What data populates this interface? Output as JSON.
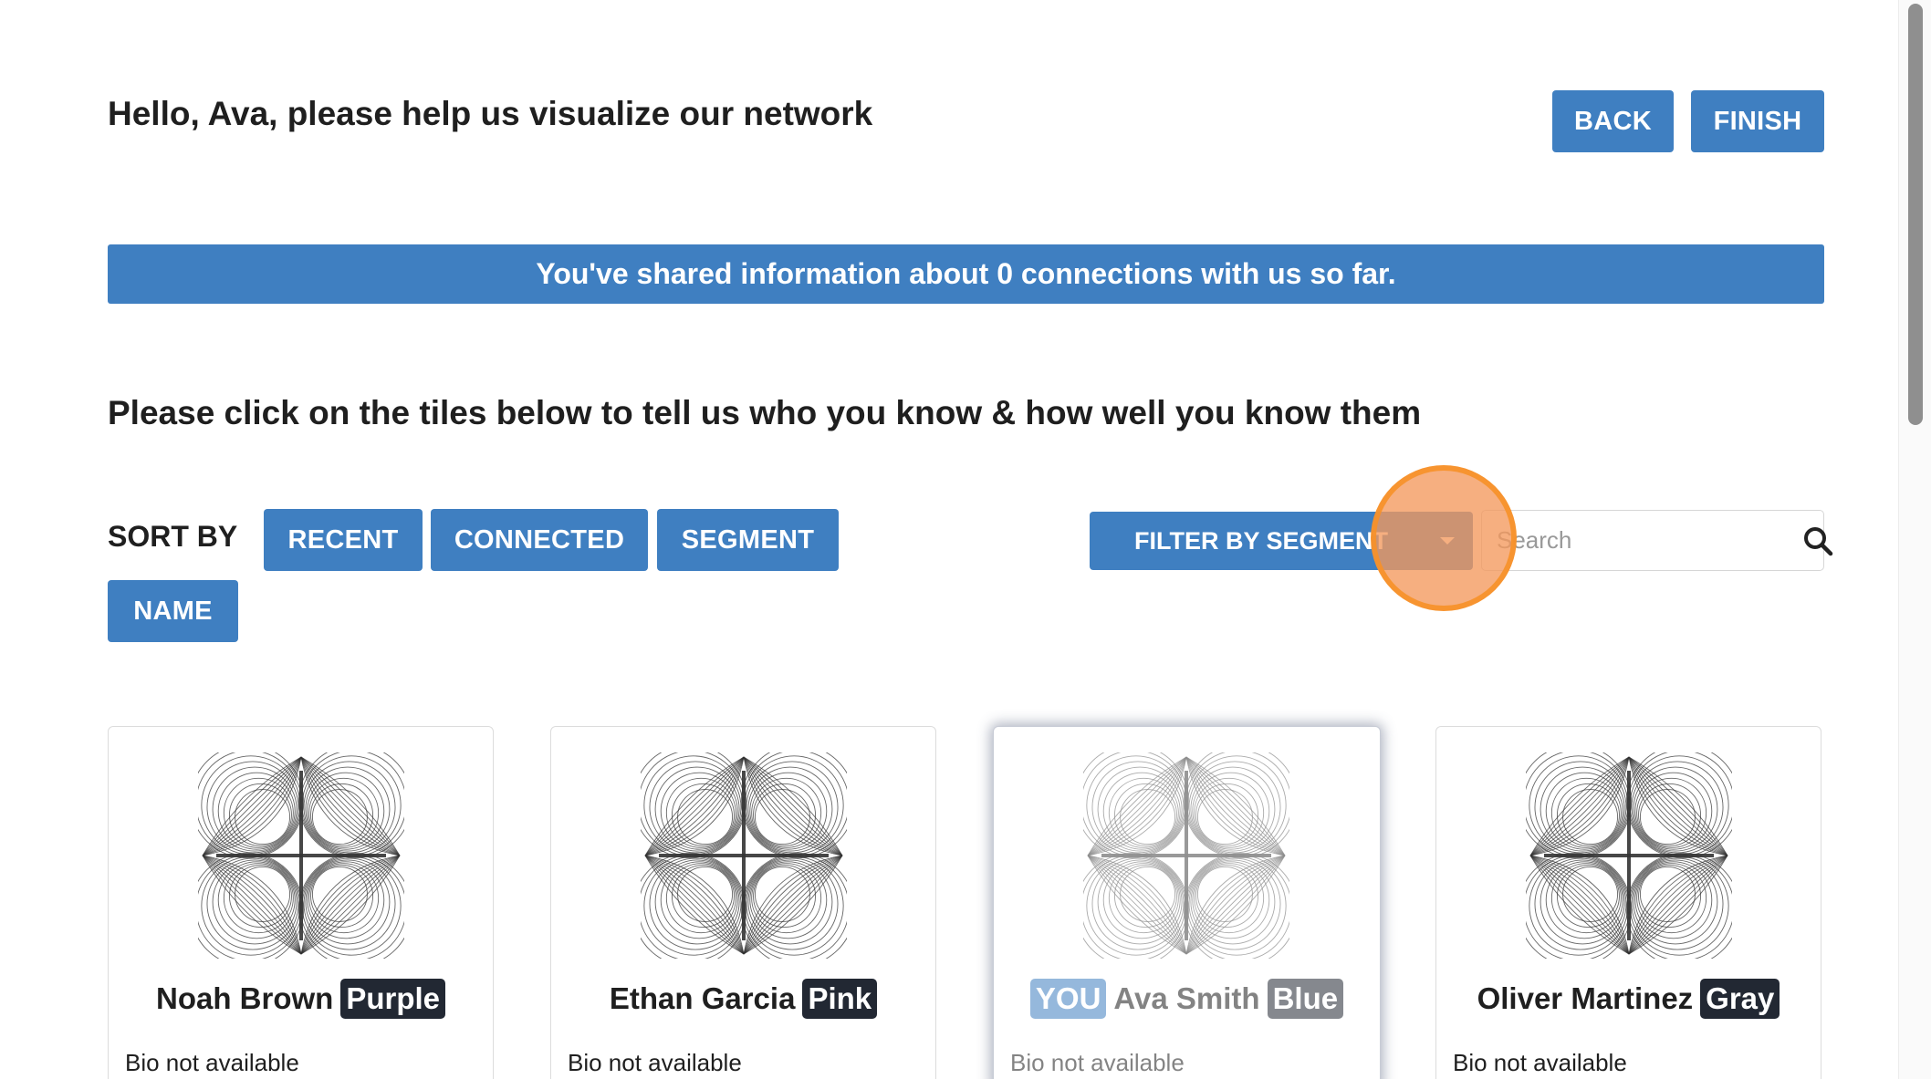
{
  "header": {
    "greeting": "Hello, Ava, please help us visualize our network",
    "back_label": "BACK",
    "finish_label": "FINISH"
  },
  "banner": {
    "text": "You've shared information about 0 connections with us so far."
  },
  "instruction": "Please click on the tiles below to tell us who you know & how well you know them",
  "sort": {
    "label": "SORT BY",
    "options": [
      "RECENT",
      "CONNECTED",
      "SEGMENT",
      "NAME"
    ]
  },
  "filter": {
    "label": "FILTER BY SEGMENT",
    "icon": "caret-down-icon"
  },
  "search": {
    "placeholder": "Search",
    "value": "",
    "icon": "search-icon"
  },
  "tiles": [
    {
      "name": "Noah Brown",
      "segment": "Purple",
      "bio": "Bio not available",
      "is_you": false,
      "you_label": ""
    },
    {
      "name": "Ethan Garcia",
      "segment": "Pink",
      "bio": "Bio not available",
      "is_you": false,
      "you_label": ""
    },
    {
      "name": "Ava Smith",
      "segment": "Blue",
      "bio": "Bio not available",
      "is_you": true,
      "you_label": "YOU"
    },
    {
      "name": "Oliver Martinez",
      "segment": "Gray",
      "bio": "Bio not available",
      "is_you": false,
      "you_label": ""
    }
  ],
  "colors": {
    "accent": "#3f7fc1",
    "badge": "#222833",
    "highlight": "#f3985c"
  }
}
